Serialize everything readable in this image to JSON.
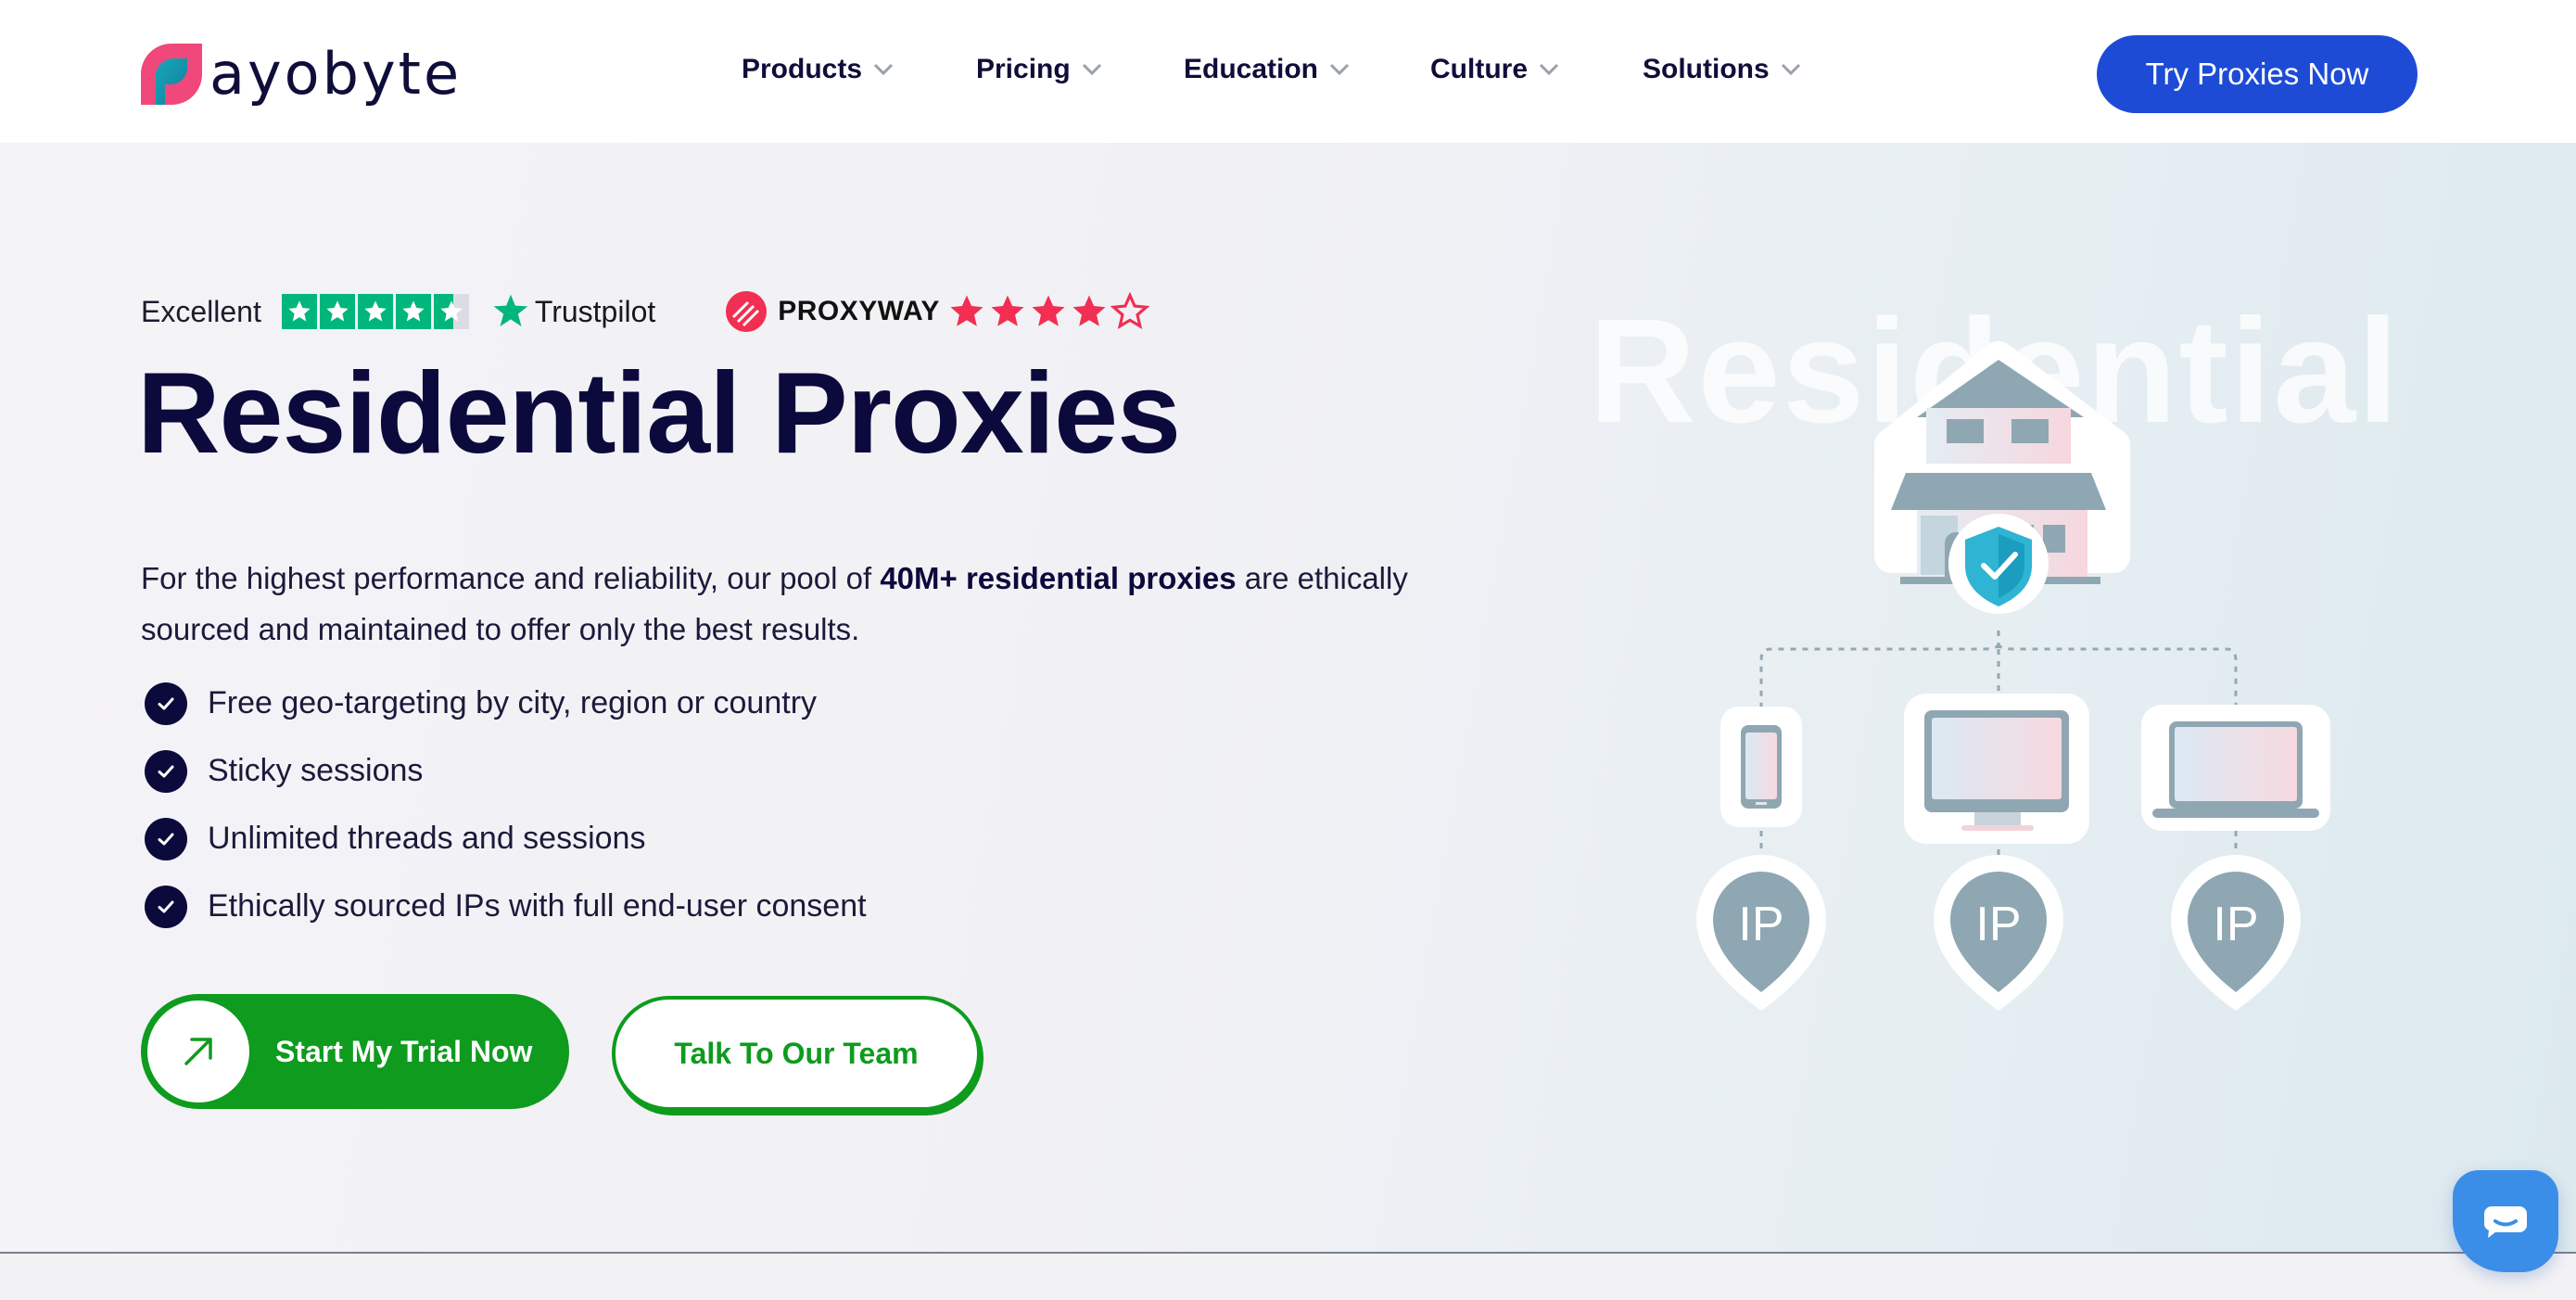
{
  "header": {
    "logo_text": "ayobyte",
    "nav": [
      {
        "label": "Products"
      },
      {
        "label": "Pricing"
      },
      {
        "label": "Education"
      },
      {
        "label": "Culture"
      },
      {
        "label": "Solutions"
      }
    ],
    "cta_label": "Try Proxies Now"
  },
  "hero": {
    "rating_label": "Excellent",
    "trustpilot_brand": "Trustpilot",
    "trustpilot_stars": 4.5,
    "proxyway_brand": "PROXYWAY",
    "proxyway_stars": 4,
    "title": "Residential Proxies",
    "desc_before": "For the highest performance and reliability, our pool of ",
    "desc_bold": "40M+ residential proxies",
    "desc_after": " are ethically sourced and maintained to offer only the best results.",
    "features": [
      "Free geo-targeting by city, region or country",
      "Sticky sessions",
      "Unlimited threads and sessions",
      "Ethically sourced IPs with full end-user consent"
    ],
    "primary_cta": "Start My Trial Now",
    "secondary_cta": "Talk To Our Team"
  },
  "illustration": {
    "watermark": "Residential",
    "ip_label": "IP"
  },
  "colors": {
    "navy": "#0c0a3c",
    "brand_blue": "#1e4bd6",
    "green": "#0e9b1e",
    "trustpilot_green": "#00b67a",
    "proxyway_red": "#f22e52",
    "logo_pink": "#f0487a",
    "logo_teal": "#1aa7b8"
  },
  "icons": {
    "logo": "ayobyte-logo-icon",
    "chevron": "chevron-down-icon",
    "check": "check-circle-icon",
    "arrow": "arrow-up-right-icon",
    "chat": "chat-bubble-icon"
  }
}
